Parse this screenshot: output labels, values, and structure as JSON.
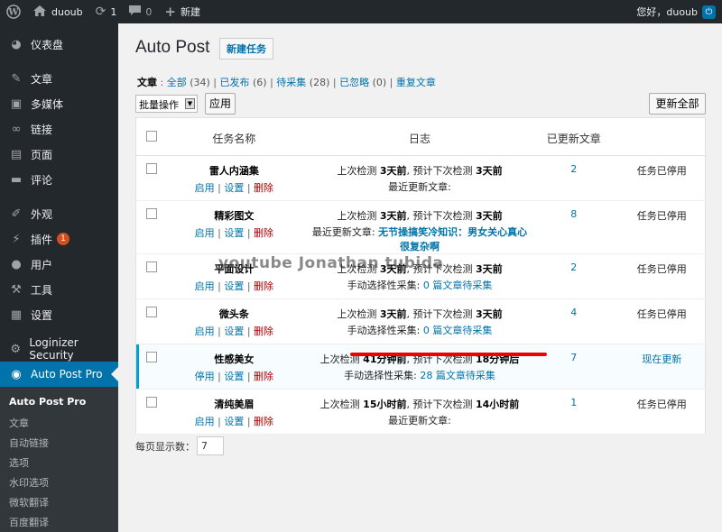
{
  "adminbar": {
    "site_name": "duoub",
    "updates_count": "1",
    "comments_count": "0",
    "new_label": "新建",
    "greeting": "您好，duoub"
  },
  "sidebar": {
    "items": [
      {
        "label": "仪表盘",
        "icon": "dashboard-icon"
      },
      {
        "label": "文章",
        "icon": "pin-icon"
      },
      {
        "label": "多媒体",
        "icon": "media-icon"
      },
      {
        "label": "链接",
        "icon": "link-icon"
      },
      {
        "label": "页面",
        "icon": "page-icon"
      },
      {
        "label": "评论",
        "icon": "comment-icon"
      },
      {
        "label": "外观",
        "icon": "brush-icon"
      },
      {
        "label": "插件",
        "icon": "plugin-icon",
        "badge": "1"
      },
      {
        "label": "用户",
        "icon": "user-icon"
      },
      {
        "label": "工具",
        "icon": "wrench-icon"
      },
      {
        "label": "设置",
        "icon": "settings-icon"
      },
      {
        "label": "Loginizer Security",
        "icon": "gear-icon"
      },
      {
        "label": "Auto Post Pro",
        "icon": "globe-icon"
      }
    ],
    "submenu": [
      "Auto Post Pro",
      "文章",
      "自动链接",
      "选项",
      "水印选项",
      "微软翻译",
      "百度翻译"
    ]
  },
  "page": {
    "title": "Auto Post",
    "add_new": "新建任务",
    "filters": {
      "label": "文章",
      "all": "全部",
      "all_count": "(34)",
      "published": "已发布",
      "published_count": "(6)",
      "pending": "待采集",
      "pending_count": "(28)",
      "ignored": "已忽略",
      "ignored_count": "(0)",
      "duplicate": "重复文章"
    },
    "bulk_action": "批量操作",
    "apply": "应用",
    "update_all": "更新全部",
    "columns": {
      "name": "任务名称",
      "log": "日志",
      "updated": "已更新文章"
    },
    "actions": {
      "enable": "启用",
      "disable": "停用",
      "settings": "设置",
      "delete": "删除",
      "sep": "|"
    },
    "rows": [
      {
        "name": "雷人内涵集",
        "toggle": "启用",
        "log1_a": "上次检测 ",
        "log1_b": "3天前",
        "log1_c": ", 预计下次检测 ",
        "log1_d": "3天前",
        "log2_prefix": "最近更新文章: ",
        "log2_link": "",
        "count": "2",
        "status": "任务已停用"
      },
      {
        "name": "精彩图文",
        "toggle": "启用",
        "log1_a": "上次检测 ",
        "log1_b": "3天前",
        "log1_c": ", 预计下次检测 ",
        "log1_d": "3天前",
        "log2_prefix": "最近更新文章: ",
        "log2_link": "无节操搞笑冷知识：男女关心真心很复杂啊",
        "count": "8",
        "status": "任务已停用"
      },
      {
        "name": "平面设计",
        "toggle": "启用",
        "log1_a": "上次检测 ",
        "log1_b": "3天前",
        "log1_c": ", 预计下次检测 ",
        "log1_d": "3天前",
        "log2_prefix": "手动选择性采集: ",
        "log2_link": "0 篇文章待采集",
        "count": "2",
        "status": "任务已停用"
      },
      {
        "name": "微头条",
        "toggle": "启用",
        "log1_a": "上次检测 ",
        "log1_b": "3天前",
        "log1_c": ", 预计下次检测 ",
        "log1_d": "3天前",
        "log2_prefix": "手动选择性采集: ",
        "log2_link": "0 篇文章待采集",
        "count": "4",
        "status": "任务已停用"
      },
      {
        "name": "性感美女",
        "toggle": "停用",
        "log1_a": "上次检测 ",
        "log1_b": "41分钟前",
        "log1_c": ", 预计下次检测 ",
        "log1_d": "18分钟后",
        "log2_prefix": "手动选择性采集: ",
        "log2_link": "28 篇文章待采集",
        "count": "7",
        "status": "现在更新"
      },
      {
        "name": "清纯美眉",
        "toggle": "启用",
        "log1_a": "上次检测 ",
        "log1_b": "15小时前",
        "log1_c": ", 预计下次检测 ",
        "log1_d": "14小时前",
        "log2_prefix": "最近更新文章: ",
        "log2_link": "",
        "count": "1",
        "status": "任务已停用"
      }
    ],
    "per_page_label": "每页显示数：",
    "per_page_value": "7"
  },
  "watermark": "youtube Jonathan tubida",
  "colors": {
    "accent": "#0073aa",
    "sidebar": "#23282d",
    "delete": "#aa0000",
    "highlight_line": "#ee0000"
  }
}
